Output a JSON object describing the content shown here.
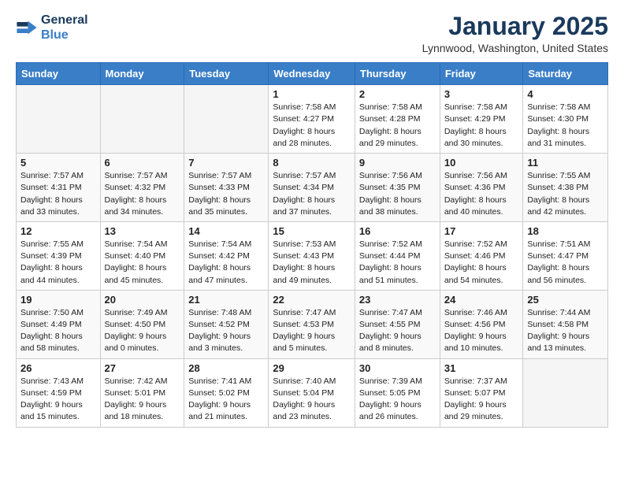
{
  "header": {
    "logo_line1": "General",
    "logo_line2": "Blue",
    "month": "January 2025",
    "location": "Lynnwood, Washington, United States"
  },
  "weekdays": [
    "Sunday",
    "Monday",
    "Tuesday",
    "Wednesday",
    "Thursday",
    "Friday",
    "Saturday"
  ],
  "weeks": [
    [
      {
        "day": "",
        "info": ""
      },
      {
        "day": "",
        "info": ""
      },
      {
        "day": "",
        "info": ""
      },
      {
        "day": "1",
        "info": "Sunrise: 7:58 AM\nSunset: 4:27 PM\nDaylight: 8 hours\nand 28 minutes."
      },
      {
        "day": "2",
        "info": "Sunrise: 7:58 AM\nSunset: 4:28 PM\nDaylight: 8 hours\nand 29 minutes."
      },
      {
        "day": "3",
        "info": "Sunrise: 7:58 AM\nSunset: 4:29 PM\nDaylight: 8 hours\nand 30 minutes."
      },
      {
        "day": "4",
        "info": "Sunrise: 7:58 AM\nSunset: 4:30 PM\nDaylight: 8 hours\nand 31 minutes."
      }
    ],
    [
      {
        "day": "5",
        "info": "Sunrise: 7:57 AM\nSunset: 4:31 PM\nDaylight: 8 hours\nand 33 minutes."
      },
      {
        "day": "6",
        "info": "Sunrise: 7:57 AM\nSunset: 4:32 PM\nDaylight: 8 hours\nand 34 minutes."
      },
      {
        "day": "7",
        "info": "Sunrise: 7:57 AM\nSunset: 4:33 PM\nDaylight: 8 hours\nand 35 minutes."
      },
      {
        "day": "8",
        "info": "Sunrise: 7:57 AM\nSunset: 4:34 PM\nDaylight: 8 hours\nand 37 minutes."
      },
      {
        "day": "9",
        "info": "Sunrise: 7:56 AM\nSunset: 4:35 PM\nDaylight: 8 hours\nand 38 minutes."
      },
      {
        "day": "10",
        "info": "Sunrise: 7:56 AM\nSunset: 4:36 PM\nDaylight: 8 hours\nand 40 minutes."
      },
      {
        "day": "11",
        "info": "Sunrise: 7:55 AM\nSunset: 4:38 PM\nDaylight: 8 hours\nand 42 minutes."
      }
    ],
    [
      {
        "day": "12",
        "info": "Sunrise: 7:55 AM\nSunset: 4:39 PM\nDaylight: 8 hours\nand 44 minutes."
      },
      {
        "day": "13",
        "info": "Sunrise: 7:54 AM\nSunset: 4:40 PM\nDaylight: 8 hours\nand 45 minutes."
      },
      {
        "day": "14",
        "info": "Sunrise: 7:54 AM\nSunset: 4:42 PM\nDaylight: 8 hours\nand 47 minutes."
      },
      {
        "day": "15",
        "info": "Sunrise: 7:53 AM\nSunset: 4:43 PM\nDaylight: 8 hours\nand 49 minutes."
      },
      {
        "day": "16",
        "info": "Sunrise: 7:52 AM\nSunset: 4:44 PM\nDaylight: 8 hours\nand 51 minutes."
      },
      {
        "day": "17",
        "info": "Sunrise: 7:52 AM\nSunset: 4:46 PM\nDaylight: 8 hours\nand 54 minutes."
      },
      {
        "day": "18",
        "info": "Sunrise: 7:51 AM\nSunset: 4:47 PM\nDaylight: 8 hours\nand 56 minutes."
      }
    ],
    [
      {
        "day": "19",
        "info": "Sunrise: 7:50 AM\nSunset: 4:49 PM\nDaylight: 8 hours\nand 58 minutes."
      },
      {
        "day": "20",
        "info": "Sunrise: 7:49 AM\nSunset: 4:50 PM\nDaylight: 9 hours\nand 0 minutes."
      },
      {
        "day": "21",
        "info": "Sunrise: 7:48 AM\nSunset: 4:52 PM\nDaylight: 9 hours\nand 3 minutes."
      },
      {
        "day": "22",
        "info": "Sunrise: 7:47 AM\nSunset: 4:53 PM\nDaylight: 9 hours\nand 5 minutes."
      },
      {
        "day": "23",
        "info": "Sunrise: 7:47 AM\nSunset: 4:55 PM\nDaylight: 9 hours\nand 8 minutes."
      },
      {
        "day": "24",
        "info": "Sunrise: 7:46 AM\nSunset: 4:56 PM\nDaylight: 9 hours\nand 10 minutes."
      },
      {
        "day": "25",
        "info": "Sunrise: 7:44 AM\nSunset: 4:58 PM\nDaylight: 9 hours\nand 13 minutes."
      }
    ],
    [
      {
        "day": "26",
        "info": "Sunrise: 7:43 AM\nSunset: 4:59 PM\nDaylight: 9 hours\nand 15 minutes."
      },
      {
        "day": "27",
        "info": "Sunrise: 7:42 AM\nSunset: 5:01 PM\nDaylight: 9 hours\nand 18 minutes."
      },
      {
        "day": "28",
        "info": "Sunrise: 7:41 AM\nSunset: 5:02 PM\nDaylight: 9 hours\nand 21 minutes."
      },
      {
        "day": "29",
        "info": "Sunrise: 7:40 AM\nSunset: 5:04 PM\nDaylight: 9 hours\nand 23 minutes."
      },
      {
        "day": "30",
        "info": "Sunrise: 7:39 AM\nSunset: 5:05 PM\nDaylight: 9 hours\nand 26 minutes."
      },
      {
        "day": "31",
        "info": "Sunrise: 7:37 AM\nSunset: 5:07 PM\nDaylight: 9 hours\nand 29 minutes."
      },
      {
        "day": "",
        "info": ""
      }
    ]
  ]
}
